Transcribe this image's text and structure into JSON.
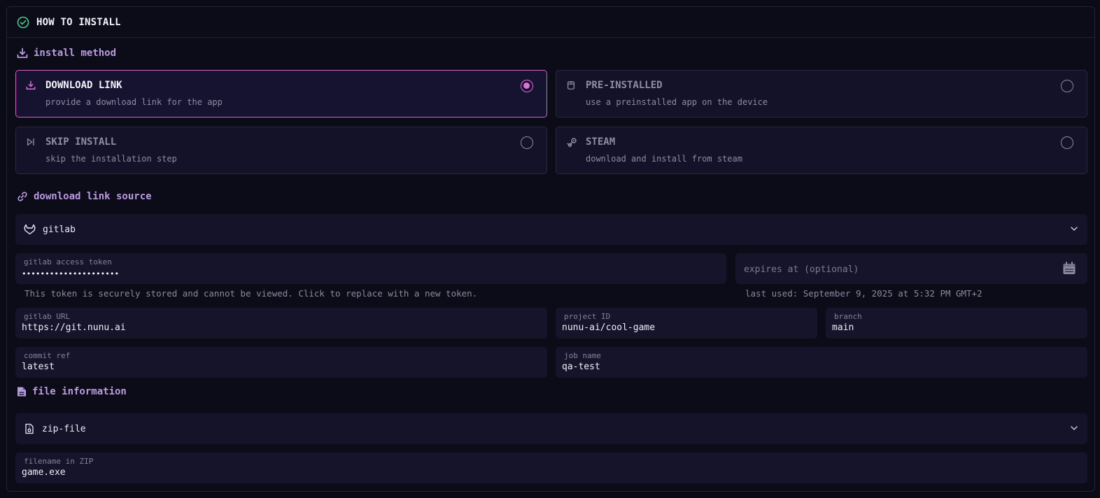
{
  "header": {
    "title": "HOW TO INSTALL",
    "icon": "check-circle-icon"
  },
  "install_method": {
    "section_title": "install method",
    "options": [
      {
        "title": "DOWNLOAD LINK",
        "description": "provide a download link for the app",
        "selected": true,
        "icon": "download-icon"
      },
      {
        "title": "PRE-INSTALLED",
        "description": "use a preinstalled app on the device",
        "selected": false,
        "icon": "device-icon"
      },
      {
        "title": "SKIP INSTALL",
        "description": "skip the installation step",
        "selected": false,
        "icon": "skip-forward-icon"
      },
      {
        "title": "STEAM",
        "description": "download and install from steam",
        "selected": false,
        "icon": "steam-icon"
      }
    ]
  },
  "download_source": {
    "section_title": "download link source",
    "selected_source": "gitlab",
    "token": {
      "label": "gitlab access token",
      "value": "•••••••••••••••••••••",
      "hint": "This token is securely stored and cannot be viewed. Click to replace with a new token."
    },
    "expires": {
      "placeholder": "expires at (optional)",
      "last_used": "last used: September 9, 2025 at 5:32 PM GMT+2"
    },
    "gitlab_url": {
      "label": "gitlab URL",
      "value": "https://git.nunu.ai"
    },
    "project_id": {
      "label": "project ID",
      "value": "nunu-ai/cool-game"
    },
    "branch": {
      "label": "branch",
      "value": "main"
    },
    "commit_ref": {
      "label": "commit ref",
      "value": "latest"
    },
    "job_name": {
      "label": "job name",
      "value": "qa-test"
    }
  },
  "file_info": {
    "section_title": "file information",
    "selected_type": "zip-file",
    "filename": {
      "label": "filename in ZIP",
      "value": "game.exe"
    }
  },
  "colors": {
    "accent": "#d45fc9",
    "section_title": "#b99be0",
    "background": "#0b0a17",
    "success": "#3fcf8e"
  }
}
